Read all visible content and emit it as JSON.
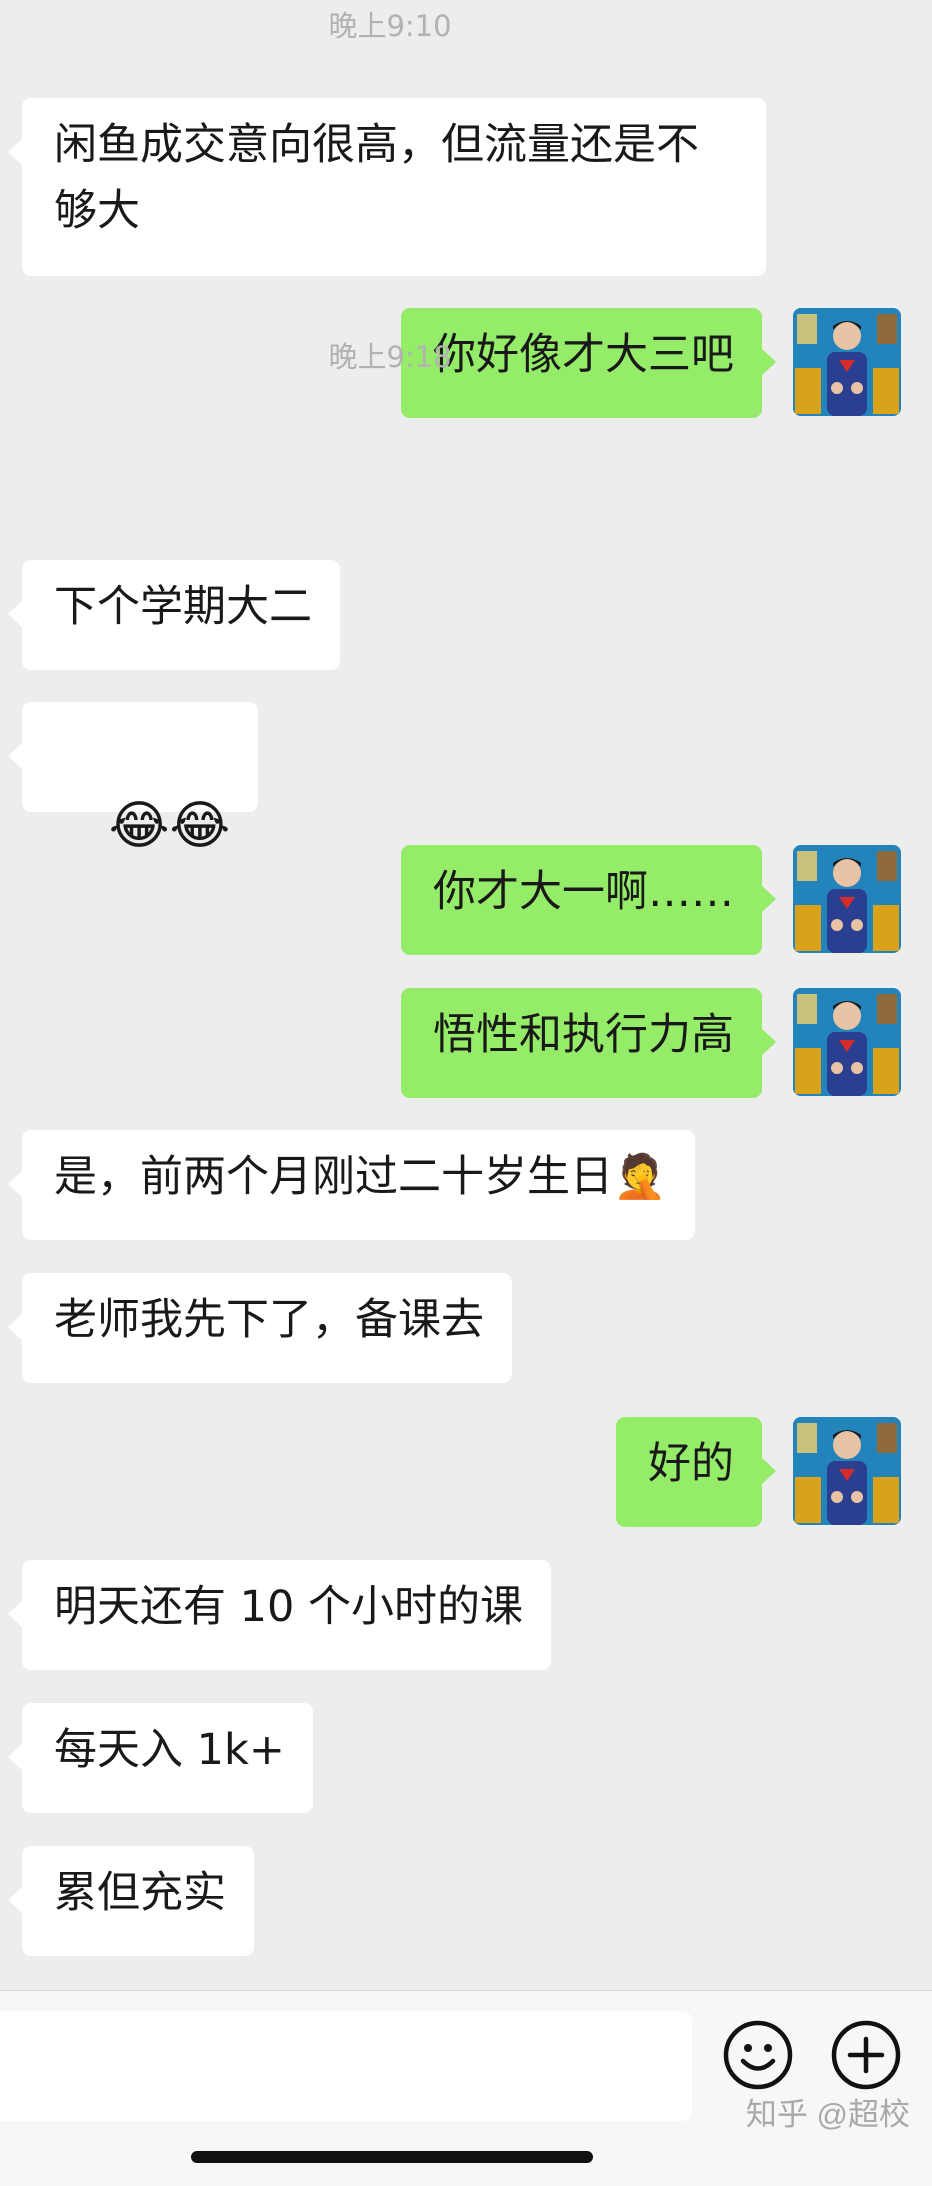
{
  "timestamps": [
    "晚上9:10",
    "晚上9:18"
  ],
  "messages": [
    {
      "from": "other",
      "text": "闲鱼成交意向很高，但流量还是不\n够大"
    },
    {
      "from": "me",
      "text": "你好像才大三吧"
    },
    {
      "from": "other",
      "text": "下个学期大二"
    },
    {
      "from": "other",
      "text": "😂😂"
    },
    {
      "from": "me",
      "text": "你才大一啊……"
    },
    {
      "from": "me",
      "text": "悟性和执行力高"
    },
    {
      "from": "other",
      "text": "是，前两个月刚过二十岁生日🤦"
    },
    {
      "from": "other",
      "text": "老师我先下了，备课去"
    },
    {
      "from": "me",
      "text": "好的"
    },
    {
      "from": "other",
      "text": "明天还有 10 个小时的课"
    },
    {
      "from": "other",
      "text": "每天入 1k+"
    },
    {
      "from": "other",
      "text": "累但充实"
    }
  ],
  "input_bar": {
    "emoji_button_icon": "smiley-face-icon",
    "add_button_icon": "plus-circle-icon"
  },
  "watermark": "知乎 @超校",
  "colors": {
    "background": "#ededed",
    "incoming_bubble": "#ffffff",
    "outgoing_bubble": "#95ec69",
    "timestamp_text": "#b2b2b2"
  }
}
